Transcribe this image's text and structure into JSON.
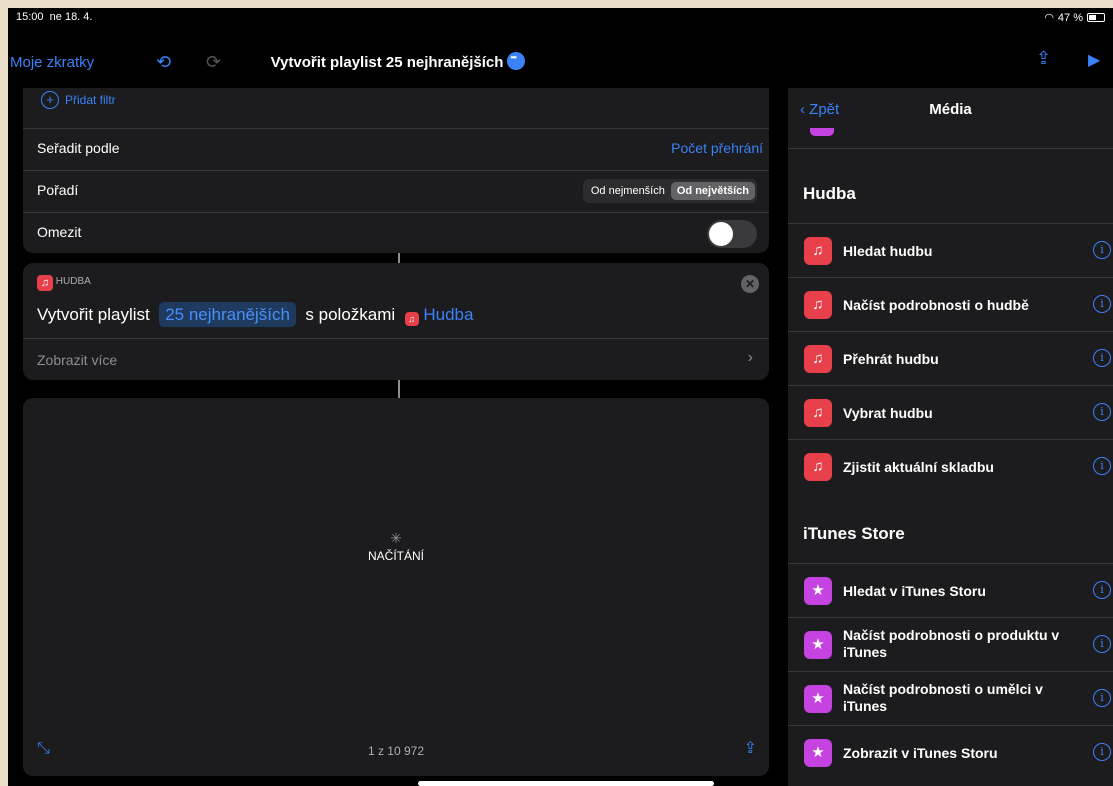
{
  "status": {
    "time": "15:00",
    "date": "ne 18. 4.",
    "battery": "47 %"
  },
  "nav": {
    "back": "Moje zkratky",
    "title": "Vytvořit playlist 25 nejhranějších"
  },
  "filters": {
    "add_filter": "Přidat filtr",
    "sort_label": "Seřadit podle",
    "sort_value": "Počet přehrání",
    "order_label": "Pořadí",
    "order_options": [
      "Od nejmenších",
      "Od největších"
    ],
    "limit_label": "Omezit"
  },
  "action": {
    "category": "HUDBA",
    "text_prefix": "Vytvořit playlist",
    "name_token": "25 nejhranějších",
    "text_mid": "s položkami",
    "items_token": "Hudba",
    "show_more": "Zobrazit více"
  },
  "preview": {
    "loading": "NAČÍTÁNÍ",
    "counter": "1 z 10 972"
  },
  "sidebar": {
    "back": "Zpět",
    "title": "Média",
    "sections": [
      {
        "title": "Hudba",
        "items": [
          "Hledat hudbu",
          "Načíst podrobnosti o hudbě",
          "Přehrát hudbu",
          "Vybrat hudbu",
          "Zjistit aktuální skladbu"
        ]
      },
      {
        "title": "iTunes Store",
        "items": [
          "Hledat v iTunes Storu",
          "Načíst podrobnosti o produktu v iTunes",
          "Načíst podrobnosti o umělci v iTunes",
          "Zobrazit v iTunes Storu"
        ]
      }
    ]
  },
  "colors": {
    "accent": "#3a82f7",
    "music": "#e8404a",
    "itunes": "#c543e0"
  }
}
